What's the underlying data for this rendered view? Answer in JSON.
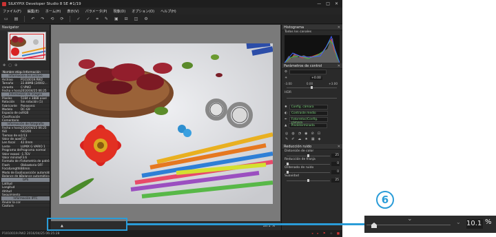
{
  "app": {
    "title": "SILKYPIX Developer Studio 8 SE   #1/19",
    "win_min": "—",
    "win_max": "□",
    "win_close": "✕"
  },
  "menu": [
    "ファイル(F)",
    "編集(E)",
    "ホーム(H)",
    "表示(V)",
    "パラメータ(P)",
    "現像(D)",
    "オプション(O)",
    "ヘルプ(H)"
  ],
  "toolbar_icons": [
    "open-icon",
    "save-icon",
    "undo-icon",
    "redo-icon",
    "rotate-left-icon",
    "rotate-right-icon",
    "develop-icon",
    "batch-icon",
    "crop-icon",
    "spot-icon",
    "fullscreen-icon",
    "print-icon",
    "compare-icon",
    "settings-icon"
  ],
  "navigator": {
    "title": "Navigator"
  },
  "info": {
    "header": "Nombre etiqu Información",
    "sections": [
      {
        "title": "Información del archivo",
        "rows": [
          [
            "Archivo",
            "P1010019.RW2"
          ],
          [
            "Tamaño",
            "22.88MB (24002..."
          ],
          [
            "carpeta",
            "C:\\PW2"
          ],
          [
            "Fecha y hora di",
            "2016/04/25 06:25"
          ]
        ]
      },
      {
        "title": "Información de imagen",
        "rows": [
          [
            "Píxeles",
            "5184 x 3888 pixel"
          ],
          [
            "Rotación",
            "Sin rotación (1)"
          ],
          [
            "Fabricante",
            "Panasonic"
          ],
          [
            "Modelo",
            "DC-G9"
          ],
          [
            "Espacio de color",
            "sRGB"
          ],
          [
            "Clasificación",
            ""
          ],
          [
            "Comentario",
            ""
          ]
        ]
      },
      {
        "title": "Información de fotografía",
        "rows": [
          [
            "Fecha y hora di",
            "2016/04/25 06:25"
          ],
          [
            "ISO",
            "ISO200"
          ],
          [
            "Tiempo de exp",
            "1/13"
          ],
          [
            "Valor de apertu",
            "F10"
          ],
          [
            "Len focal",
            "42.0mm"
          ],
          [
            "Lente",
            "LUMIX G VARIO 1"
          ],
          [
            "Programa de e",
            "Programa normal"
          ],
          [
            "Valor exposi",
            "-1.7EV"
          ],
          [
            "Valor mínimo (",
            "F3.6"
          ],
          [
            "Formato de me",
            "Fotometría de patrón"
          ],
          [
            "Flash",
            "Obligatorio OFF"
          ],
          [
            "FocalLengthIn",
            "84mm"
          ],
          [
            "Modo de Expos",
            "Exposición automática"
          ],
          [
            "Balance de blan",
            "Balance automático"
          ]
        ]
      },
      {
        "title": "GPS",
        "rows": [
          [
            "Latitud",
            ""
          ],
          [
            "Longitud",
            ""
          ],
          [
            "Altitud",
            ""
          ],
          [
            "Seguimiento G",
            ""
          ]
        ]
      },
      {
        "title": "Información IPTC",
        "rows": [
          [
            "Anular la corrección",
            ""
          ],
          [
            "Captura",
            ""
          ]
        ]
      }
    ]
  },
  "viewer": {
    "zoom_value": "10.1",
    "zoom_unit": "%"
  },
  "status": {
    "left": "P1010019.RW2 2016/04/25 06:25:28",
    "right_icons": [
      "shadow-warning-icon",
      "highlight-warning-icon",
      "flag-icon",
      "rating-icon",
      "stop-icon"
    ]
  },
  "histogram": {
    "title": "Histograma",
    "channel_label": "Todos los canales"
  },
  "control": {
    "title": "Parámetros de control",
    "exposure": "+0.00",
    "ev_min": "-3.00",
    "ev_zero": "0.00",
    "ev_max": "+3.00",
    "hdr_label": "HDR",
    "tone_label": "Config. cámara",
    "contrast_label": "Contraste medio",
    "color_label": "Fotorretoc/Config. cámara",
    "sharp_label": "Predeterminada"
  },
  "noise": {
    "title": "Reducción ruido",
    "rows": [
      {
        "label": "Distorsión de color",
        "value": "25",
        "level": 0.5
      },
      {
        "label": "Reducción de franja",
        "value": "0",
        "level": 0
      },
      {
        "label": "Ordenado de ruido",
        "value": "0",
        "level": 0
      },
      {
        "label": "Suavidad",
        "value": "25",
        "level": 0.5
      }
    ]
  },
  "callout": {
    "number": "6"
  },
  "colors": {
    "accent": "#2a9cd8"
  }
}
